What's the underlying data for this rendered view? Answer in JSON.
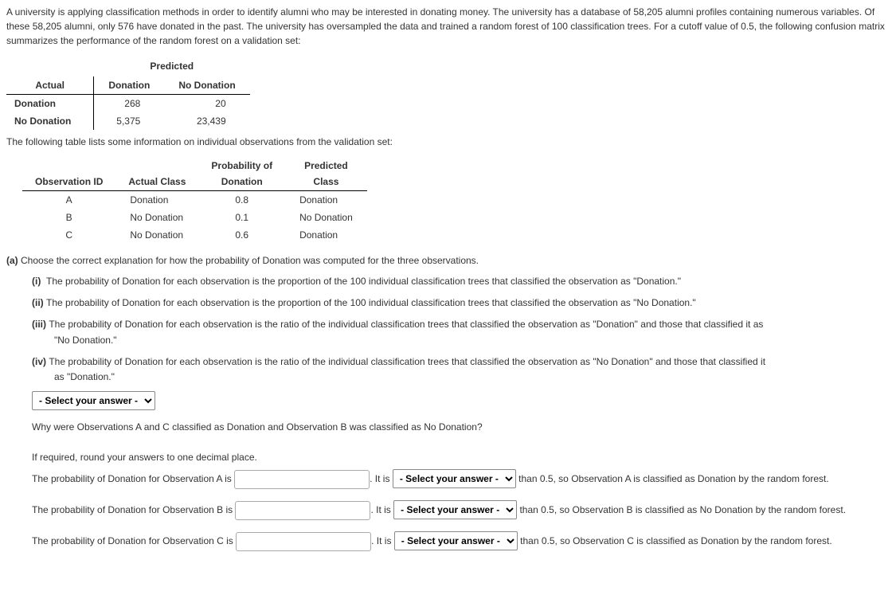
{
  "intro": "A university is applying classification methods in order to identify alumni who may be interested in donating money. The university has a database of 58,205 alumni profiles containing numerous variables. Of these 58,205 alumni, only 576 have donated in the past. The university has oversampled the data and trained a random forest of 100 classification trees. For a cutoff value of 0.5, the following confusion matrix summarizes the performance of the random forest on a validation set:",
  "matrix": {
    "super": "Predicted",
    "corner": "Actual",
    "cols": [
      "Donation",
      "No Donation"
    ],
    "rows": [
      {
        "label": "Donation",
        "c1": "268",
        "c2": "20"
      },
      {
        "label": "No Donation",
        "c1": "5,375",
        "c2": "23,439"
      }
    ]
  },
  "mid_text": "The following table lists some information on individual observations from the validation set:",
  "obs": {
    "headers": {
      "h1": "Observation ID",
      "h2": "Actual Class",
      "h3a": "Probability of",
      "h3b": "Donation",
      "h4a": "Predicted",
      "h4b": "Class"
    },
    "rows": [
      {
        "id": "A",
        "actual": "Donation",
        "prob": "0.8",
        "pred": "Donation"
      },
      {
        "id": "B",
        "actual": "No Donation",
        "prob": "0.1",
        "pred": "No Donation"
      },
      {
        "id": "C",
        "actual": "No Donation",
        "prob": "0.6",
        "pred": "Donation"
      }
    ]
  },
  "part_a_label": "(a)",
  "part_a_text": "Choose the correct explanation for how the probability of Donation was computed for the three observations.",
  "options": {
    "i_num": "(i)",
    "i_text": "The probability of Donation for each observation is the proportion of the 100 individual classification trees that classified the observation as \"Donation.\"",
    "ii_num": "(ii)",
    "ii_text": "The probability of Donation for each observation is the proportion of the 100 individual classification trees that classified the observation as \"No Donation.\"",
    "iii_num": "(iii)",
    "iii_text_a": "The probability of Donation for each observation is the ratio of the individual classification trees that classified the observation as \"Donation\" and those that classified it as",
    "iii_text_b": "\"No Donation.\"",
    "iv_num": "(iv)",
    "iv_text_a": "The probability of Donation for each observation is the ratio of the individual classification trees that classified the observation as \"No Donation\" and those that classified it",
    "iv_text_b": "as \"Donation.\""
  },
  "select_placeholder": "- Select your answer -",
  "why_q": "Why were Observations A and C classified as Donation and Observation B was classified as No Donation?",
  "round_note": "If required, round your answers to one decimal place.",
  "fill": {
    "a_pre": "The probability of Donation for Observation A is ",
    "a_mid": ". It is ",
    "a_post": " than 0.5, so Observation A is classified as Donation by the random forest.",
    "b_pre": "The probability of Donation for Observation B is ",
    "b_mid": ". It is ",
    "b_post": " than 0.5, so Observation B is classified as No Donation by the random forest.",
    "c_pre": "The probability of Donation for Observation C is ",
    "c_mid": ". It is ",
    "c_post": " than 0.5, so Observation C is classified as Donation by the random forest."
  }
}
